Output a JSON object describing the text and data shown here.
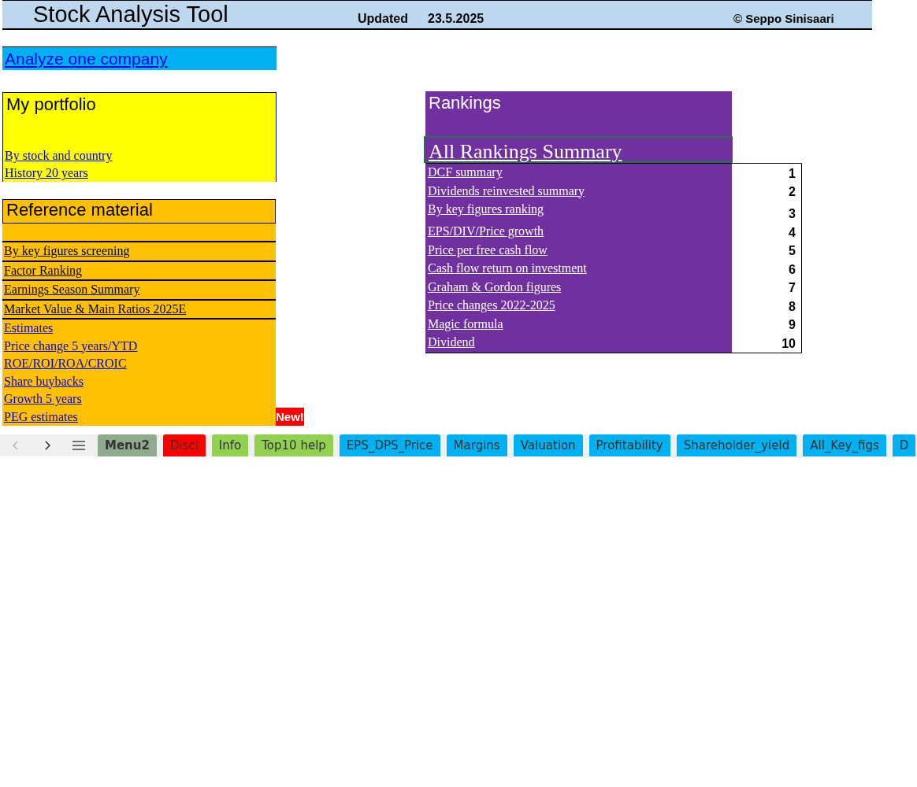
{
  "header": {
    "title": "Stock Analysis Tool",
    "updated_label": "Updated",
    "updated_date": "23.5.2025",
    "copyright": "© Seppo Sinisaari"
  },
  "analyze_link": "Analyze one company",
  "portfolio": {
    "title": "My portfolio",
    "links": [
      "By stock and country",
      "History 20 years"
    ]
  },
  "reference": {
    "title": "Reference material",
    "links": [
      {
        "label": "By key figures screening",
        "kind": "boxed"
      },
      {
        "label": "Factor Ranking",
        "kind": "boxed"
      },
      {
        "label": "Earnings Season Summary",
        "kind": "boxed"
      },
      {
        "label": "Market Value & Main Ratios 2025E",
        "kind": "boxed"
      },
      {
        "label": "Estimates",
        "kind": "link"
      },
      {
        "label": "Price change 5 years/YTD",
        "kind": "link"
      },
      {
        "label": "ROE/ROI/ROA/CROIC",
        "kind": "link"
      },
      {
        "label": "Share buybacks",
        "kind": "link"
      },
      {
        "label": "Growth 5 years",
        "kind": "link"
      },
      {
        "label": "PEG estimates",
        "kind": "link"
      }
    ]
  },
  "new_badge": "New!",
  "rankings": {
    "title": "Rankings",
    "summary_link": "All Rankings Summary",
    "items": [
      {
        "label": "DCF summary",
        "number": "1"
      },
      {
        "label": "Dividends reinvested summary",
        "number": "2"
      },
      {
        "label": "By key figures ranking",
        "number": "3"
      },
      {
        "label": "EPS/DIV/Price growth",
        "number": "4"
      },
      {
        "label": "Price per free cash flow",
        "number": "5"
      },
      {
        "label": "Cash flow return on investment",
        "number": "6"
      },
      {
        "label": "Graham & Gordon figures",
        "number": "7"
      },
      {
        "label": "Price changes 2022-2025",
        "number": "8"
      },
      {
        "label": "Magic formula",
        "number": "9"
      },
      {
        "label": "Dividend",
        "number": "10"
      }
    ]
  },
  "sheet_nav": {
    "prev_disabled": true,
    "next_disabled": false
  },
  "sheet_tabs": [
    {
      "label": "Menu2",
      "selected": true,
      "color": "#8faa8c"
    },
    {
      "label": "Discl",
      "selected": false,
      "color": "#ff0000"
    },
    {
      "label": "Info",
      "selected": false,
      "color": "#92d050"
    },
    {
      "label": "Top10 help",
      "selected": false,
      "color": "#92d050"
    },
    {
      "label": "EPS_DPS_Price",
      "selected": false,
      "color": "#00b0f0"
    },
    {
      "label": "Margins",
      "selected": false,
      "color": "#00b0f0"
    },
    {
      "label": "Valuation",
      "selected": false,
      "color": "#00b0f0"
    },
    {
      "label": "Profitability",
      "selected": false,
      "color": "#00b0f0"
    },
    {
      "label": "Shareholder_yield",
      "selected": false,
      "color": "#00b0f0"
    },
    {
      "label": "All_Key_figs",
      "selected": false,
      "color": "#00b0f0"
    },
    {
      "label": "D",
      "selected": false,
      "color": "#00b0f0"
    }
  ]
}
